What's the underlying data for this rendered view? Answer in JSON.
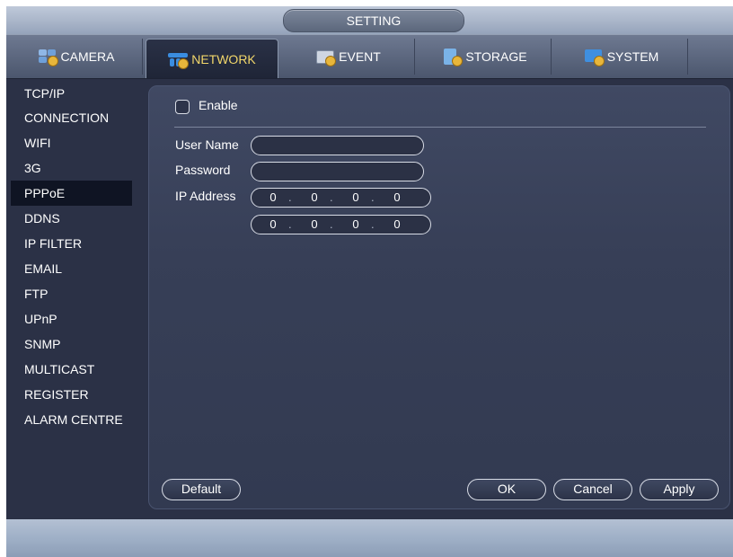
{
  "window": {
    "title": "SETTING"
  },
  "tabs": [
    {
      "label": "CAMERA",
      "icon": "camera-settings-icon",
      "active": false
    },
    {
      "label": "NETWORK",
      "icon": "network-settings-icon",
      "active": true
    },
    {
      "label": "EVENT",
      "icon": "event-settings-icon",
      "active": false
    },
    {
      "label": "STORAGE",
      "icon": "storage-settings-icon",
      "active": false
    },
    {
      "label": "SYSTEM",
      "icon": "system-settings-icon",
      "active": false
    }
  ],
  "sidebar": {
    "items": [
      {
        "label": "TCP/IP"
      },
      {
        "label": "CONNECTION"
      },
      {
        "label": "WIFI"
      },
      {
        "label": "3G"
      },
      {
        "label": "PPPoE",
        "active": true
      },
      {
        "label": "DDNS"
      },
      {
        "label": "IP FILTER"
      },
      {
        "label": "EMAIL"
      },
      {
        "label": "FTP"
      },
      {
        "label": "UPnP"
      },
      {
        "label": "SNMP"
      },
      {
        "label": "MULTICAST"
      },
      {
        "label": "REGISTER"
      },
      {
        "label": "ALARM CENTRE"
      }
    ]
  },
  "form": {
    "enable": {
      "label": "Enable",
      "checked": false
    },
    "username": {
      "label": "User Name",
      "value": ""
    },
    "password": {
      "label": "Password",
      "value": ""
    },
    "ip_address": {
      "label": "IP Address",
      "primary": [
        "0",
        "0",
        "0",
        "0"
      ],
      "secondary": [
        "0",
        "0",
        "0",
        "0"
      ]
    }
  },
  "buttons": {
    "default": "Default",
    "ok": "OK",
    "cancel": "Cancel",
    "apply": "Apply"
  },
  "colors": {
    "background": "#2b3146",
    "active_tab_text": "#f2d76a",
    "accent_gear": "#e8b63b"
  }
}
